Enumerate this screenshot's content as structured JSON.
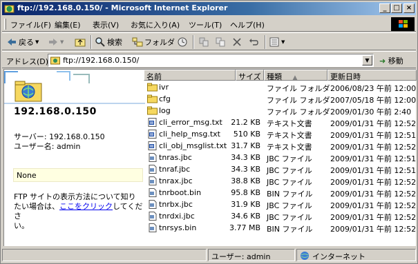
{
  "window": {
    "title": "ftp://192.168.0.150/ - Microsoft Internet Explorer",
    "buttons": [
      "_",
      "□",
      "×"
    ]
  },
  "menu": [
    "ファイル(F)",
    "編集(E)",
    "表示(V)",
    "お気に入り(A)",
    "ツール(T)",
    "ヘルプ(H)"
  ],
  "toolbar": {
    "back_label": "戻る",
    "search_label": "検索",
    "folders_label": "フォルダ",
    "back_icon": "back-arrow-icon",
    "forward_icon": "forward-arrow-icon",
    "up_icon": "up-folder-icon"
  },
  "address": {
    "label": "アドレス(D)",
    "url": "ftp://192.168.0.150/",
    "go_label": "移動"
  },
  "left_pane": {
    "server": "192.168.0.150",
    "server_line": "サーバー: 192.168.0.150",
    "user_line": "ユーザー名: admin",
    "info_box": "None",
    "help_text_1": "FTP サイトの表示方法について知り",
    "help_text_2": "たい場合は、",
    "help_link": "ここをクリック",
    "help_text_3": "してくださ",
    "help_text_4": "い。"
  },
  "columns": {
    "name": "名前",
    "size": "サイズ",
    "type": "種類",
    "modified": "更新日時",
    "sort_indicator": "▲"
  },
  "files": [
    {
      "name": "ivr",
      "size": "",
      "type": "ファイル フォルダ",
      "date": "2006/08/23 午前 12:00",
      "icon": "folder"
    },
    {
      "name": "cfg",
      "size": "",
      "type": "ファイル フォルダ",
      "date": "2007/05/18 午前 12:00",
      "icon": "folder"
    },
    {
      "name": "log",
      "size": "",
      "type": "ファイル フォルダ",
      "date": "2009/01/30 午前 2:40",
      "icon": "folder"
    },
    {
      "name": "cli_error_msg.txt",
      "size": "21.2 KB",
      "type": "テキスト文書",
      "date": "2009/01/31 午前 12:52",
      "icon": "text"
    },
    {
      "name": "cli_help_msg.txt",
      "size": "510 KB",
      "type": "テキスト文書",
      "date": "2009/01/31 午前 12:51",
      "icon": "text"
    },
    {
      "name": "cli_obj_msglist.txt",
      "size": "31.7 KB",
      "type": "テキスト文書",
      "date": "2009/01/31 午前 12:52",
      "icon": "text"
    },
    {
      "name": "tnras.jbc",
      "size": "34.3 KB",
      "type": "JBC ファイル",
      "date": "2009/01/31 午前 12:51",
      "icon": "file"
    },
    {
      "name": "tnraf.jbc",
      "size": "34.3 KB",
      "type": "JBC ファイル",
      "date": "2009/01/31 午前 12:51",
      "icon": "file"
    },
    {
      "name": "tnrax.jbc",
      "size": "38.8 KB",
      "type": "JBC ファイル",
      "date": "2009/01/31 午前 12:52",
      "icon": "file"
    },
    {
      "name": "tnrboot.bin",
      "size": "95.8 KB",
      "type": "BIN ファイル",
      "date": "2009/01/31 午前 12:52",
      "icon": "file"
    },
    {
      "name": "tnrbx.jbc",
      "size": "31.9 KB",
      "type": "JBC ファイル",
      "date": "2009/01/31 午前 12:52",
      "icon": "file"
    },
    {
      "name": "tnrdxi.jbc",
      "size": "34.6 KB",
      "type": "JBC ファイル",
      "date": "2009/01/31 午前 12:52",
      "icon": "file"
    },
    {
      "name": "tnrsys.bin",
      "size": "3.77 MB",
      "type": "BIN ファイル",
      "date": "2009/01/31 午前 12:52",
      "icon": "file"
    }
  ],
  "status": {
    "user": "ユーザー: admin",
    "zone": "インターネット"
  }
}
